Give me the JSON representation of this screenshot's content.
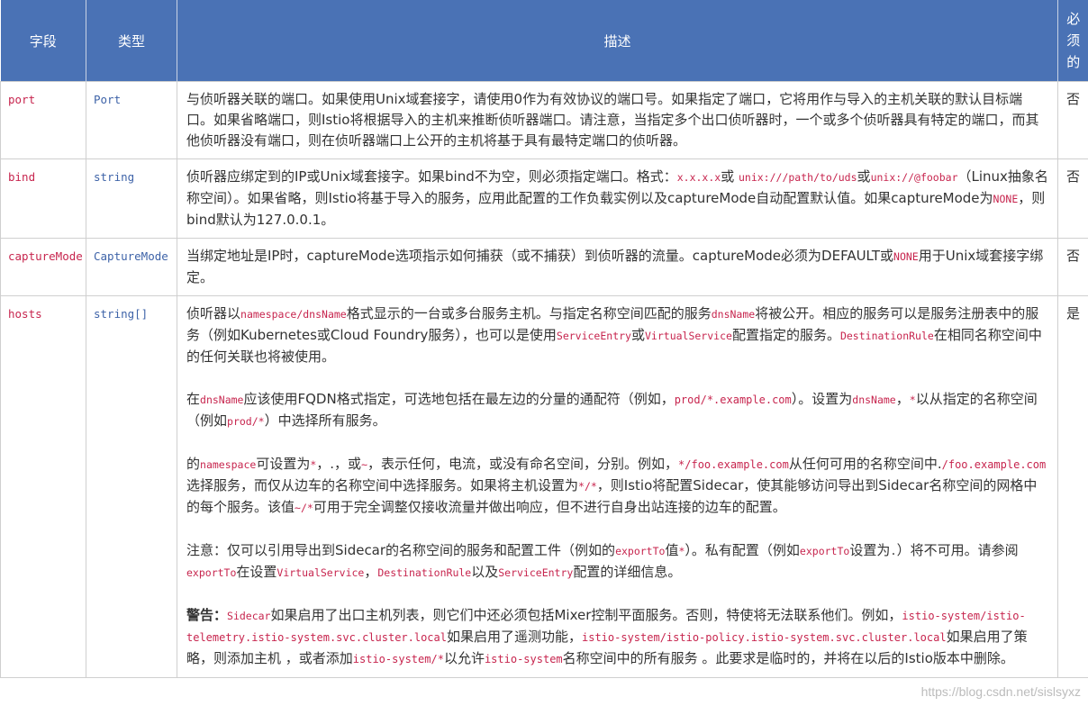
{
  "header": {
    "field": "字段",
    "type": "类型",
    "desc": "描述",
    "required": [
      "必",
      "须",
      "的"
    ]
  },
  "rows": {
    "port": {
      "name": "port",
      "type": "Port",
      "required": "否",
      "desc": "与侦听器关联的端口。如果使用Unix域套接字，请使用0作为有效协议的端口号。如果指定了端口，它将用作与导入的主机关联的默认目标端口。如果省略端口，则Istio将根据导入的主机来推断侦听器端口。请注意，当指定多个出口侦听器时，一个或多个侦听器具有特定的端口，而其他侦听器没有端口，则在侦听器端口上公开的主机将基于具有最特定端口的侦听器。"
    },
    "bind": {
      "name": "bind",
      "type": "string",
      "required": "否",
      "t1": "侦听器应绑定到的IP或Unix域套接字。如果bind不为空，则必须指定端口。格式：",
      "c1": "x.x.x.x",
      "t2": "或 ",
      "c2": "unix:///path/to/uds",
      "t3": "或",
      "c3": "unix://@foobar",
      "t4": "（Linux抽象名称空间）。如果省略，则Istio将基于导入的服务，应用此配置的工作负载实例以及captureMode自动配置默认值。如果captureMode为",
      "c4": "NONE",
      "t5": "，则bind默认为127.0.0.1。"
    },
    "capture": {
      "name": "captureMode",
      "type": "CaptureMode",
      "required": "否",
      "t1": "当绑定地址是IP时，captureMode选项指示如何捕获（或不捕获）到侦听器的流量。captureMode必须为DEFAULT或",
      "c1": "NONE",
      "t2": "用于Unix域套接字绑定。"
    },
    "hosts": {
      "name": "hosts",
      "type": "string[]",
      "required": "是",
      "p1": {
        "t1": "侦听器以",
        "c1": "namespace/dnsName",
        "t2": "格式显示的一台或多台服务主机。与指定名称空间匹配的服务",
        "c2": "dnsName",
        "t3": "将被公开。相应的服务可以是服务注册表中的服务（例如Kubernetes或Cloud Foundry服务），也可以是使用",
        "c3": "ServiceEntry",
        "t4": "或",
        "c4": "VirtualService",
        "t5": "配置指定的服务。",
        "c5": "DestinationRule",
        "t6": "在相同名称空间中的任何关联也将被使用。"
      },
      "p2": {
        "t1": "在",
        "c1": "dnsName",
        "t2": "应该使用FQDN格式指定，可选地包括在最左边的分量的通配符（例如，",
        "c2": "prod/*.example.com",
        "t3": "）。设置为",
        "c3": "dnsName",
        "t4": "，",
        "c4": "*",
        "t5": "以从指定的名称空间（例如",
        "c5": "prod/*",
        "t6": "）中选择所有服务。"
      },
      "p3": {
        "t1": "的",
        "c1": "namespace",
        "t2": "可设置为",
        "c2": "*",
        "t3": "，.，或",
        "c3": "~",
        "t4": "，表示任何，电流，或没有命名空间，分别。例如，",
        "c4": "*/foo.example.com",
        "t5": "从任何可用的名称空间中.",
        "c5": "/foo.example.com",
        "t6": "选择服务，而仅从边车的名称空间中选择服务。如果将主机设置为",
        "c6": "*/*",
        "t7": "，则Istio将配置Sidecar，使其能够访问导出到Sidecar名称空间的网格中的每个服务。该值",
        "c7": "~/*",
        "t8": "可用于完全调整仅接收流量并做出响应，但不进行自身出站连接的边车的配置。"
      },
      "p4": {
        "t1": "注意：仅可以引用导出到Sidecar的名称空间的服务和配置工件（例如的",
        "c1": "exportTo",
        "t2": "值",
        "c2": "*",
        "t3": "）。私有配置（例如",
        "c3": "exportTo",
        "t4": "设置为",
        "d1": ".",
        "t5": "）将不可用。请参阅",
        "c4": "exportTo",
        "t6": "在设置",
        "c5": "VirtualService",
        "t7": "，",
        "c6": "DestinationRule",
        "t8": "以及",
        "c7": "ServiceEntry",
        "t9": "配置的详细信息。"
      },
      "p5": {
        "b1": "警告：",
        "c1": "Sidecar",
        "t1": "如果启用了出口主机列表，则它们中还必须包括Mixer控制平面服务。否则，特使将无法联系他们。例如，",
        "c2": "istio-system/istio-telemetry.istio-system.svc.cluster.local",
        "t2": "如果启用了遥测功能，",
        "c3": "istio-system/istio-policy.istio-system.svc.cluster.local",
        "t3": "如果启用了策略，则添加主机 ，或者添加",
        "c4": "istio-system/*",
        "t4": "以允许",
        "c5": "istio-system",
        "t5": "名称空间中的所有服务 。此要求是临时的，并将在以后的Istio版本中删除。"
      }
    }
  },
  "watermark": "https://blog.csdn.net/sislsyxz"
}
